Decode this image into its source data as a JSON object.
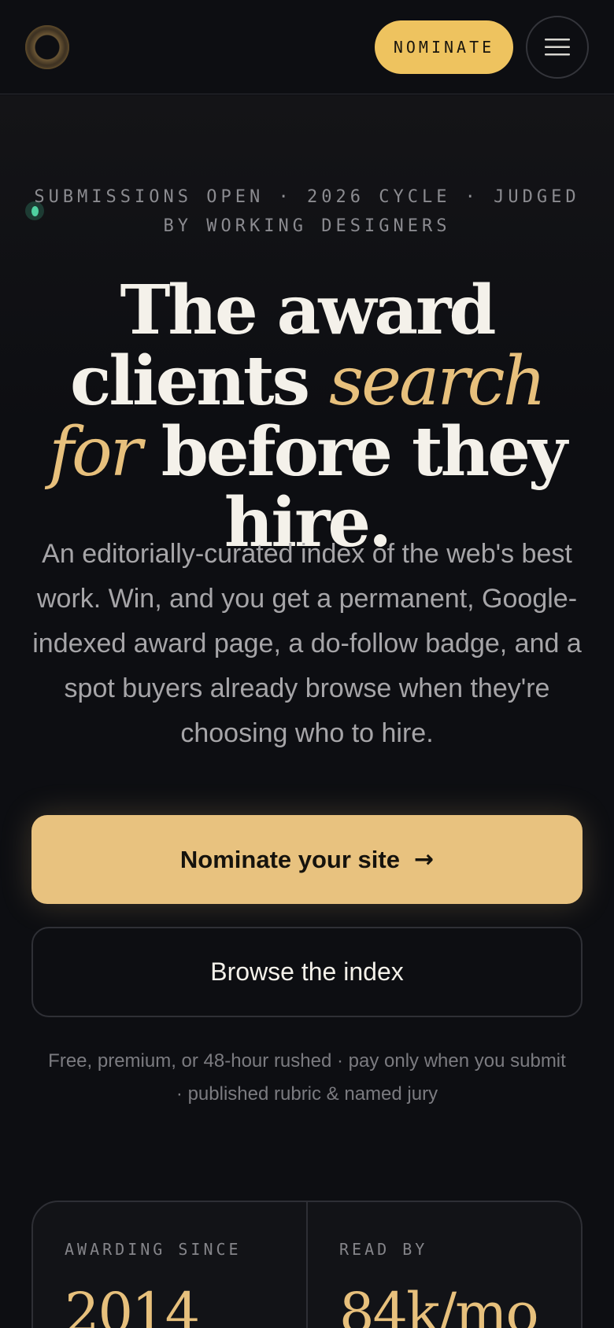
{
  "header": {
    "nominate_label": "NOMINATE",
    "logo_icon": "ring-logo-icon",
    "menu_icon": "hamburger-menu-icon"
  },
  "hero": {
    "eyebrow": "SUBMISSIONS OPEN · 2026 CYCLE · JUDGED BY WORKING DESIGNERS",
    "headline_part1": "The award clients",
    "headline_emphasis": "search for",
    "headline_part2": "before they hire.",
    "lede": "An editorially-curated index of the web's best work. Win, and you get a permanent, Google-indexed award page, a do-follow badge, and a spot buyers already browse when they're choosing who to hire.",
    "primary_cta": "Nominate your site",
    "primary_cta_arrow": "→",
    "secondary_cta": "Browse the index",
    "fineprint": "Free, premium, or 48-hour rushed · pay only when you submit · published rubric & named jury"
  },
  "stats": [
    {
      "label": "AWARDING SINCE",
      "value": "2014"
    },
    {
      "label": "READ BY",
      "value": "84k/mo"
    }
  ],
  "colors": {
    "background": "#0d0e12",
    "accent": "#e8c27f",
    "status_dot": "#4fd0a0"
  }
}
